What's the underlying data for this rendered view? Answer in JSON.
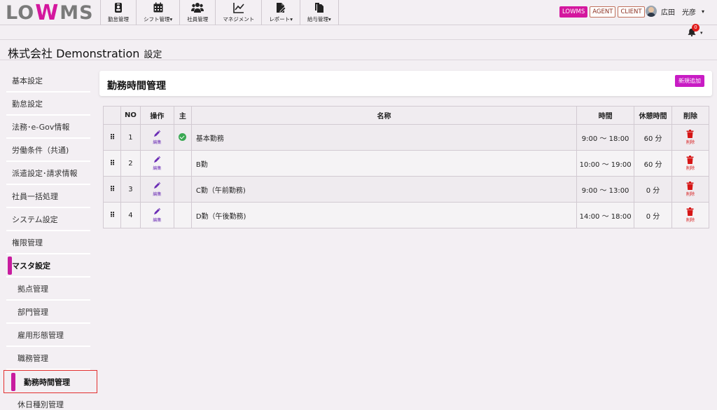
{
  "app": {
    "logo": "LOWMS",
    "logo_parts": [
      "LO",
      "W",
      "MS"
    ]
  },
  "nav": [
    {
      "label": "勤怠管理",
      "icon": "id-badge-icon"
    },
    {
      "label": "シフト管理▾",
      "icon": "calendar-icon"
    },
    {
      "label": "社員管理",
      "icon": "users-icon"
    },
    {
      "label": "マネジメント",
      "icon": "chart-line-icon"
    },
    {
      "label": "レポート▾",
      "icon": "file-pen-icon"
    },
    {
      "label": "給与管理▾",
      "icon": "copy-icon"
    }
  ],
  "badges": [
    "LOWMS",
    "AGENT",
    "CLIENT"
  ],
  "user": {
    "name": "広田　光彦",
    "caret": "▾"
  },
  "notifications": {
    "count": "0",
    "caret": "▾"
  },
  "page": {
    "company": "株式会社 Demonstration",
    "section": "設定"
  },
  "sidebar": [
    {
      "label": "基本設定"
    },
    {
      "label": "勤怠設定"
    },
    {
      "label": "法務･e-Gov情報"
    },
    {
      "label": "労働条件（共通)"
    },
    {
      "label": "派遣設定･請求情報"
    },
    {
      "label": "社員一括処理"
    },
    {
      "label": "システム設定"
    },
    {
      "label": "権限管理"
    },
    {
      "label": "マスタ設定"
    },
    {
      "label": "拠点管理"
    },
    {
      "label": "部門管理"
    },
    {
      "label": "雇用形態管理"
    },
    {
      "label": "職務管理"
    },
    {
      "label": "勤務時間管理"
    },
    {
      "label": "休日種別管理"
    }
  ],
  "main": {
    "title": "勤務時間管理",
    "add_button": "新規追加",
    "columns": [
      "",
      "NO",
      "操作",
      "主",
      "名称",
      "時間",
      "休憩時間",
      "削除"
    ],
    "edit_label": "編集",
    "delete_label": "削除",
    "rows": [
      {
        "no": "1",
        "primary": true,
        "name": "基本勤務",
        "time": "9:00 〜 18:00",
        "break": "60 分"
      },
      {
        "no": "2",
        "primary": false,
        "name": "B勤",
        "time": "10:00 〜 19:00",
        "break": "60 分"
      },
      {
        "no": "3",
        "primary": false,
        "name": "C勤（午前勤務)",
        "time": "9:00 〜 13:00",
        "break": "0 分"
      },
      {
        "no": "4",
        "primary": false,
        "name": "D勤（午後勤務)",
        "time": "14:00 〜 18:00",
        "break": "0 分"
      }
    ]
  },
  "colors": {
    "accent": "#c81c9f",
    "brand_w": "#d4179e",
    "edit": "#6b2db5",
    "delete": "#d61616",
    "check": "#3aa853"
  }
}
